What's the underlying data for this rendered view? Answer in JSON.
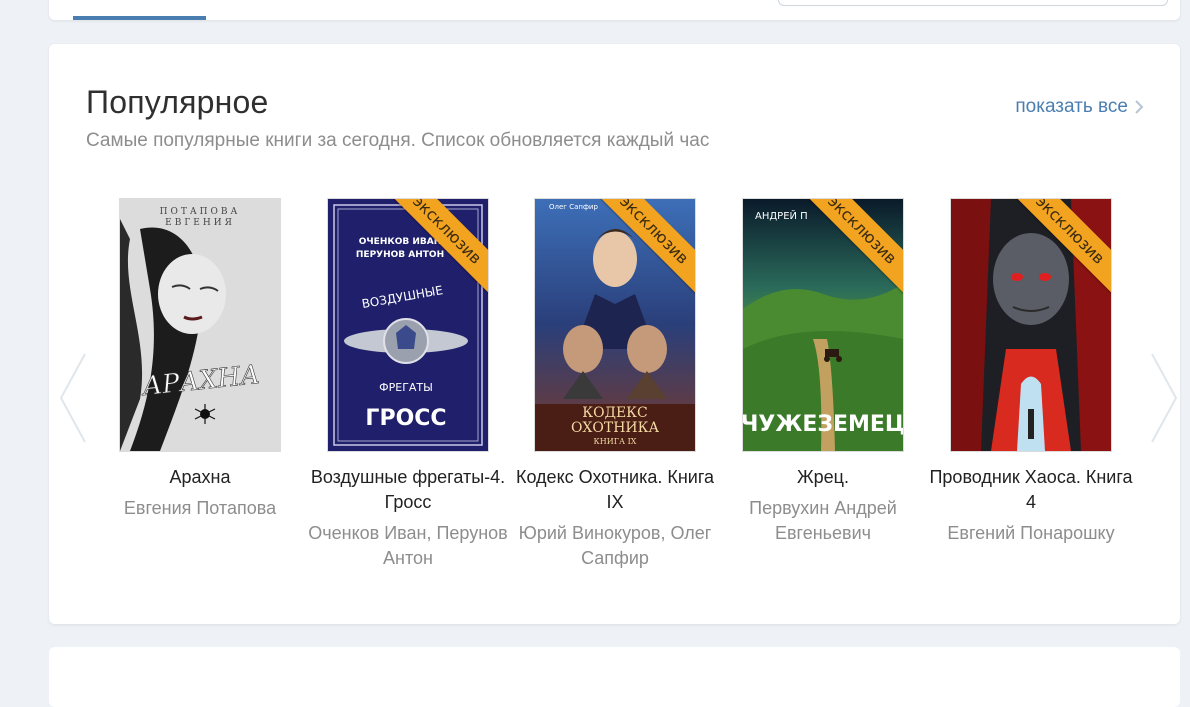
{
  "section": {
    "title": "Популярное",
    "subtitle": "Самые популярные книги за сегодня. Список обновляется каждый час",
    "show_all": "показать все"
  },
  "badge": "эксклюзив",
  "books": [
    {
      "title": "Арахна",
      "author": "Евгения Потапова",
      "cover_text_top": "ПОТАПОВА ЕВГЕНИЯ",
      "cover_text_main": "АРАХНА",
      "exclusive": false
    },
    {
      "title": "Воздушные фрегаты-4. Гросс",
      "author": "Оченков Иван, Перунов Антон",
      "cover_text_top": "ОЧЕНКОВ ИВАН ПЕРУНОВ АНТОН",
      "cover_text_arc": "ВОЗДУШНЫЕ",
      "cover_text_arc2": "ФРЕГАТЫ",
      "cover_text_main": "ГРОСС",
      "exclusive": true
    },
    {
      "title": "Кодекс Охотника. Книга IX",
      "author": "Юрий Винокуров, Олег Сапфир",
      "cover_text_top": "Олег Сапфир",
      "cover_text_main": "КОДЕКС ОХОТНИКА",
      "cover_text_sub": "КНИГА IX",
      "exclusive": true
    },
    {
      "title": "Жрец.",
      "author": "Первухин Андрей Евгеньевич",
      "cover_text_top": "АНДРЕЙ П",
      "cover_text_main": "ЧУЖЕЗЕМЕЦ",
      "exclusive": true
    },
    {
      "title": "Проводник Хаоса. Книга 4",
      "author": "Евгений Понарошку",
      "exclusive": true
    }
  ],
  "colors": {
    "accent": "#4a7eb0",
    "badge": "#f2a31f",
    "background": "#eef2f6"
  }
}
